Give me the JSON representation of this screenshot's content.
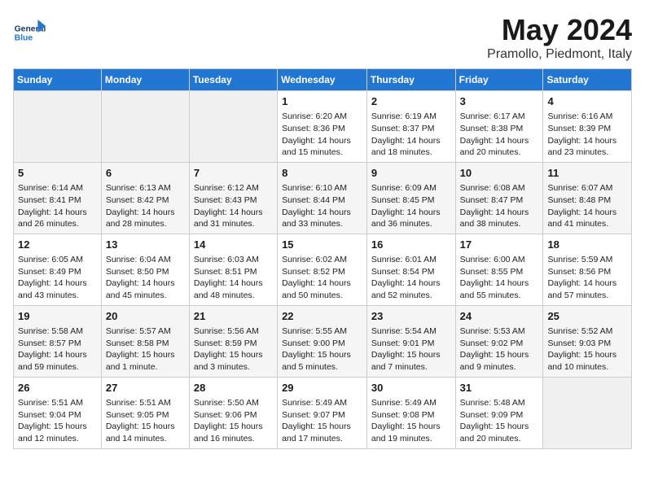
{
  "header": {
    "logo_general": "General",
    "logo_blue": "Blue",
    "title": "May 2024",
    "subtitle": "Pramollo, Piedmont, Italy"
  },
  "days_of_week": [
    "Sunday",
    "Monday",
    "Tuesday",
    "Wednesday",
    "Thursday",
    "Friday",
    "Saturday"
  ],
  "weeks": [
    [
      {
        "day": "",
        "info": ""
      },
      {
        "day": "",
        "info": ""
      },
      {
        "day": "",
        "info": ""
      },
      {
        "day": "1",
        "info": "Sunrise: 6:20 AM\nSunset: 8:36 PM\nDaylight: 14 hours and 15 minutes."
      },
      {
        "day": "2",
        "info": "Sunrise: 6:19 AM\nSunset: 8:37 PM\nDaylight: 14 hours and 18 minutes."
      },
      {
        "day": "3",
        "info": "Sunrise: 6:17 AM\nSunset: 8:38 PM\nDaylight: 14 hours and 20 minutes."
      },
      {
        "day": "4",
        "info": "Sunrise: 6:16 AM\nSunset: 8:39 PM\nDaylight: 14 hours and 23 minutes."
      }
    ],
    [
      {
        "day": "5",
        "info": "Sunrise: 6:14 AM\nSunset: 8:41 PM\nDaylight: 14 hours and 26 minutes."
      },
      {
        "day": "6",
        "info": "Sunrise: 6:13 AM\nSunset: 8:42 PM\nDaylight: 14 hours and 28 minutes."
      },
      {
        "day": "7",
        "info": "Sunrise: 6:12 AM\nSunset: 8:43 PM\nDaylight: 14 hours and 31 minutes."
      },
      {
        "day": "8",
        "info": "Sunrise: 6:10 AM\nSunset: 8:44 PM\nDaylight: 14 hours and 33 minutes."
      },
      {
        "day": "9",
        "info": "Sunrise: 6:09 AM\nSunset: 8:45 PM\nDaylight: 14 hours and 36 minutes."
      },
      {
        "day": "10",
        "info": "Sunrise: 6:08 AM\nSunset: 8:47 PM\nDaylight: 14 hours and 38 minutes."
      },
      {
        "day": "11",
        "info": "Sunrise: 6:07 AM\nSunset: 8:48 PM\nDaylight: 14 hours and 41 minutes."
      }
    ],
    [
      {
        "day": "12",
        "info": "Sunrise: 6:05 AM\nSunset: 8:49 PM\nDaylight: 14 hours and 43 minutes."
      },
      {
        "day": "13",
        "info": "Sunrise: 6:04 AM\nSunset: 8:50 PM\nDaylight: 14 hours and 45 minutes."
      },
      {
        "day": "14",
        "info": "Sunrise: 6:03 AM\nSunset: 8:51 PM\nDaylight: 14 hours and 48 minutes."
      },
      {
        "day": "15",
        "info": "Sunrise: 6:02 AM\nSunset: 8:52 PM\nDaylight: 14 hours and 50 minutes."
      },
      {
        "day": "16",
        "info": "Sunrise: 6:01 AM\nSunset: 8:54 PM\nDaylight: 14 hours and 52 minutes."
      },
      {
        "day": "17",
        "info": "Sunrise: 6:00 AM\nSunset: 8:55 PM\nDaylight: 14 hours and 55 minutes."
      },
      {
        "day": "18",
        "info": "Sunrise: 5:59 AM\nSunset: 8:56 PM\nDaylight: 14 hours and 57 minutes."
      }
    ],
    [
      {
        "day": "19",
        "info": "Sunrise: 5:58 AM\nSunset: 8:57 PM\nDaylight: 14 hours and 59 minutes."
      },
      {
        "day": "20",
        "info": "Sunrise: 5:57 AM\nSunset: 8:58 PM\nDaylight: 15 hours and 1 minute."
      },
      {
        "day": "21",
        "info": "Sunrise: 5:56 AM\nSunset: 8:59 PM\nDaylight: 15 hours and 3 minutes."
      },
      {
        "day": "22",
        "info": "Sunrise: 5:55 AM\nSunset: 9:00 PM\nDaylight: 15 hours and 5 minutes."
      },
      {
        "day": "23",
        "info": "Sunrise: 5:54 AM\nSunset: 9:01 PM\nDaylight: 15 hours and 7 minutes."
      },
      {
        "day": "24",
        "info": "Sunrise: 5:53 AM\nSunset: 9:02 PM\nDaylight: 15 hours and 9 minutes."
      },
      {
        "day": "25",
        "info": "Sunrise: 5:52 AM\nSunset: 9:03 PM\nDaylight: 15 hours and 10 minutes."
      }
    ],
    [
      {
        "day": "26",
        "info": "Sunrise: 5:51 AM\nSunset: 9:04 PM\nDaylight: 15 hours and 12 minutes."
      },
      {
        "day": "27",
        "info": "Sunrise: 5:51 AM\nSunset: 9:05 PM\nDaylight: 15 hours and 14 minutes."
      },
      {
        "day": "28",
        "info": "Sunrise: 5:50 AM\nSunset: 9:06 PM\nDaylight: 15 hours and 16 minutes."
      },
      {
        "day": "29",
        "info": "Sunrise: 5:49 AM\nSunset: 9:07 PM\nDaylight: 15 hours and 17 minutes."
      },
      {
        "day": "30",
        "info": "Sunrise: 5:49 AM\nSunset: 9:08 PM\nDaylight: 15 hours and 19 minutes."
      },
      {
        "day": "31",
        "info": "Sunrise: 5:48 AM\nSunset: 9:09 PM\nDaylight: 15 hours and 20 minutes."
      },
      {
        "day": "",
        "info": ""
      }
    ]
  ]
}
